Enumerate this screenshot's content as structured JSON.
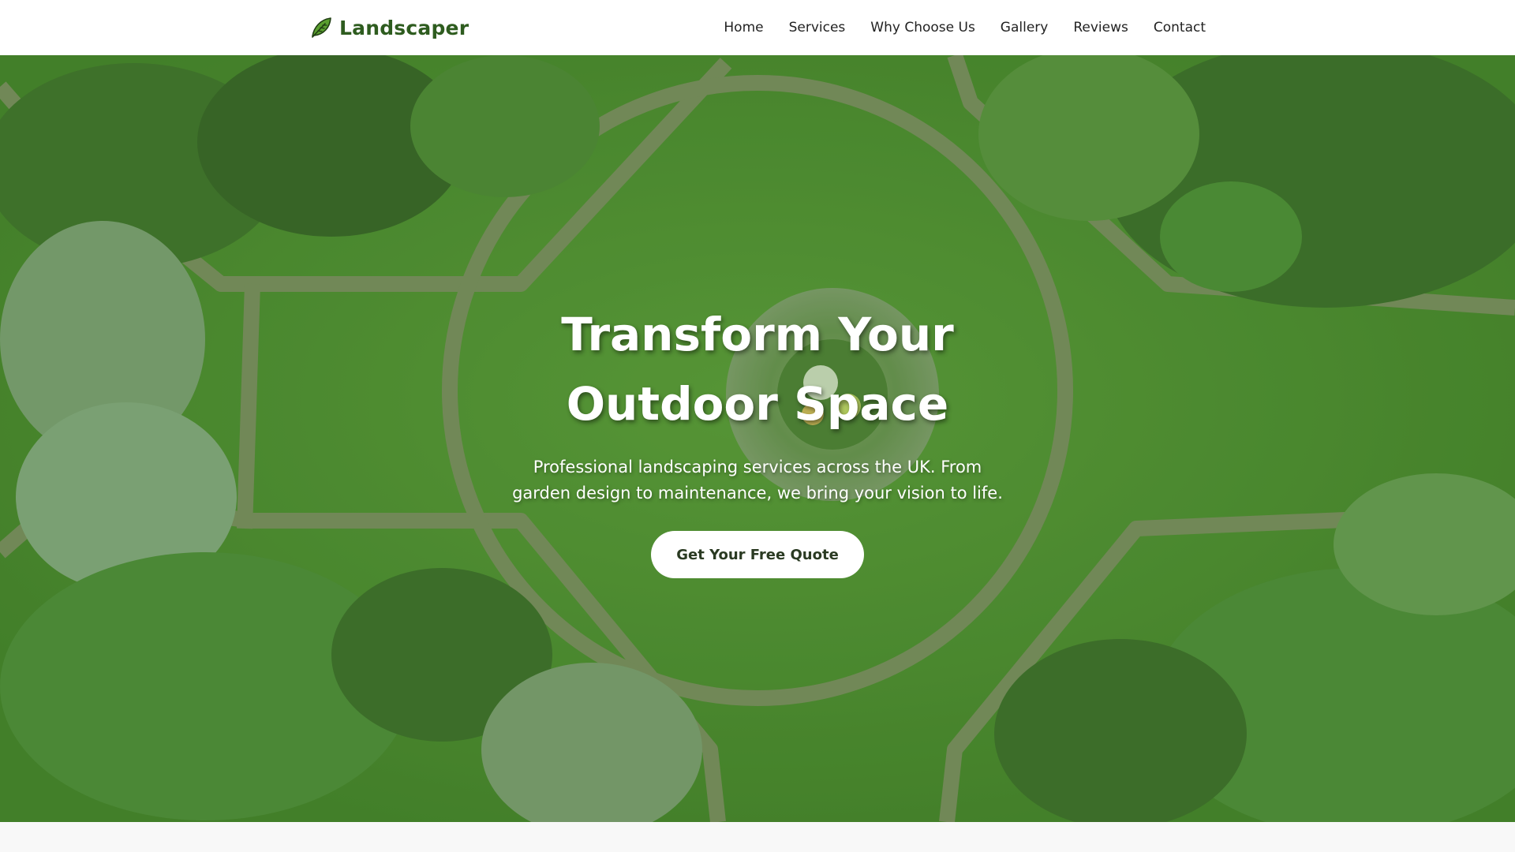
{
  "brand": {
    "name": "Landscaper",
    "icon": "leaf-icon",
    "color": "#2e5c1f"
  },
  "nav": {
    "items": [
      {
        "label": "Home"
      },
      {
        "label": "Services"
      },
      {
        "label": "Why Choose Us"
      },
      {
        "label": "Gallery"
      },
      {
        "label": "Reviews"
      },
      {
        "label": "Contact"
      }
    ]
  },
  "hero": {
    "title_line1": "Transform Your",
    "title_line2": "Outdoor Space",
    "subtitle_line1": "Professional landscaping services across the UK. From",
    "subtitle_line2": "garden design to maintenance, we bring your vision to life.",
    "cta_label": "Get Your Free Quote",
    "background": "aerial-garden-lawn-image"
  },
  "colors": {
    "accent": "#2e5c1f",
    "lawn": "#4d8a31",
    "cta_bg": "#ffffff"
  }
}
